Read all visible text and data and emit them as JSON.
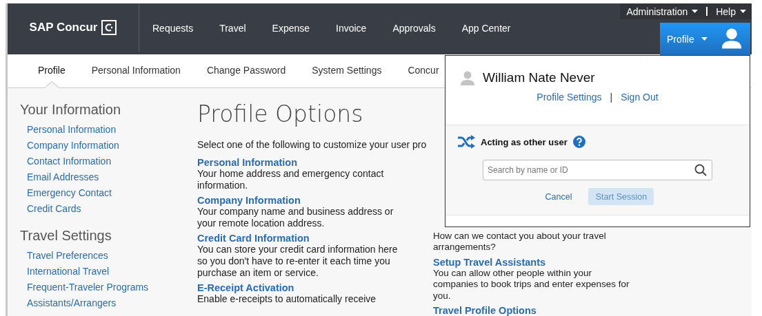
{
  "header": {
    "logo": "SAP Concur",
    "nav": [
      "Requests",
      "Travel",
      "Expense",
      "Invoice",
      "Approvals",
      "App Center"
    ],
    "utility": [
      "Administration",
      "Help"
    ],
    "profile_button": "Profile"
  },
  "subnav": [
    {
      "label": "Profile",
      "selected": true
    },
    {
      "label": "Personal Information",
      "selected": false
    },
    {
      "label": "Change Password",
      "selected": false
    },
    {
      "label": "System Settings",
      "selected": false
    },
    {
      "label": "Concur",
      "selected": false
    }
  ],
  "sidebar": [
    {
      "title": "Your Information",
      "items": [
        "Personal Information",
        "Company Information",
        "Contact Information",
        "Email Addresses",
        "Emergency Contact",
        "Credit Cards"
      ]
    },
    {
      "title": "Travel Settings",
      "items": [
        "Travel Preferences",
        "International Travel",
        "Frequent-Traveler Programs",
        "Assistants/Arrangers"
      ]
    }
  ],
  "main": {
    "title": "Profile Options",
    "intro": "Select one of the following to customize your user pro",
    "options": [
      {
        "title": "Personal Information",
        "text": "Your home address and emergency contact information."
      },
      {
        "title": "Company Information",
        "text": "Your company name and business address or your remote location address."
      },
      {
        "title": "Credit Card Information",
        "text": "You can store your credit card information here so you don't have to re-enter it each time you purchase an item or service."
      },
      {
        "title": "E-Receipt Activation",
        "text": "Enable e-receipts to automatically receive"
      }
    ],
    "right_options": [
      {
        "text": "How can we contact you about your travel arrangements?"
      },
      {
        "title": "Setup Travel Assistants",
        "text": "You can allow other people within your companies to book trips and enter expenses for you."
      },
      {
        "title": "Travel Profile Options"
      }
    ]
  },
  "profile_menu": {
    "user_name": "William Nate Never",
    "links": [
      "Profile Settings",
      "Sign Out"
    ],
    "separator": "|",
    "acting_title": "Acting as other user",
    "search": {
      "placeholder": "Search by name or ID"
    },
    "cancel": "Cancel",
    "start": {
      "label": "Start Session",
      "disabled": true
    }
  }
}
